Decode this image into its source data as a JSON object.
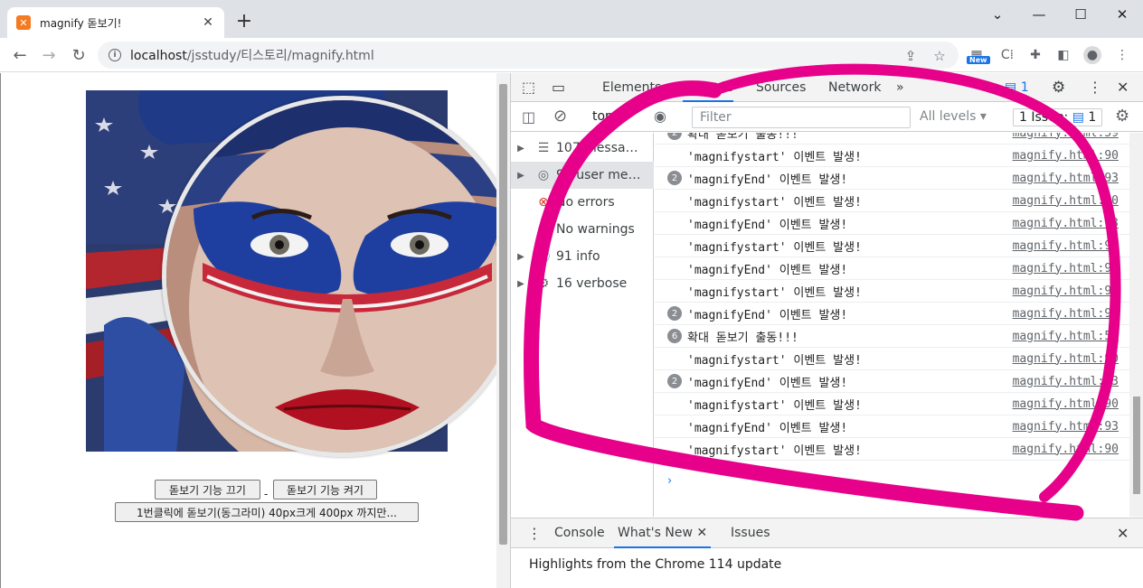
{
  "browser": {
    "tab_title": "magnify 돋보기!",
    "favicon": "xampp",
    "url_host": "localhost",
    "url_path": "/jsstudy/티스토리/magnify.html",
    "new_badge": "New"
  },
  "page": {
    "sep": "-",
    "btn_off": "돋보기 기능 끄기",
    "btn_on": "돋보기 기능 켜기",
    "btn_size": "1번클릭에 돋보기(동그라미) 40px크게 400px 까지만..."
  },
  "devtools": {
    "tabs": {
      "elements": "Elements",
      "console": "Console",
      "sources": "Sources",
      "network": "Network",
      "more": "»"
    },
    "issue_badge": "1",
    "context": "top",
    "filter_placeholder": "Filter",
    "levels": "All levels",
    "issues_label": "1 Issue:",
    "issues_count": "1",
    "sidebar": [
      {
        "label": "107 messa…",
        "icon": "list-icon"
      },
      {
        "label": "91 user me…",
        "icon": "user-icon"
      },
      {
        "label": "No errors",
        "icon": "error-icon"
      },
      {
        "label": "No warnings",
        "icon": "warning-icon"
      },
      {
        "label": "91 info",
        "icon": "info-icon"
      },
      {
        "label": "16 verbose",
        "icon": "verbose-icon"
      }
    ],
    "log": [
      {
        "count": "2",
        "text": "확대 돋보기 출동!!!",
        "src": "magnify.html:59"
      },
      {
        "count": "",
        "text": "'magnifystart' 이벤트 발생!",
        "src": "magnify.html:90"
      },
      {
        "count": "2",
        "text": "'magnifyEnd' 이벤트 발생!",
        "src": "magnify.html:93"
      },
      {
        "count": "",
        "text": "'magnifystart' 이벤트 발생!",
        "src": "magnify.html:90"
      },
      {
        "count": "",
        "text": "'magnifyEnd' 이벤트 발생!",
        "src": "magnify.html:93"
      },
      {
        "count": "",
        "text": "'magnifystart' 이벤트 발생!",
        "src": "magnify.html:90"
      },
      {
        "count": "",
        "text": "'magnifyEnd' 이벤트 발생!",
        "src": "magnify.html:93"
      },
      {
        "count": "",
        "text": "'magnifystart' 이벤트 발생!",
        "src": "magnify.html:90"
      },
      {
        "count": "2",
        "text": "'magnifyEnd' 이벤트 발생!",
        "src": "magnify.html:93"
      },
      {
        "count": "6",
        "text": "확대 돋보기 출동!!!",
        "src": "magnify.html:59"
      },
      {
        "count": "",
        "text": "'magnifystart' 이벤트 발생!",
        "src": "magnify.html:90"
      },
      {
        "count": "2",
        "text": "'magnifyEnd' 이벤트 발생!",
        "src": "magnify.html:93"
      },
      {
        "count": "",
        "text": "'magnifystart' 이벤트 발생!",
        "src": "magnify.html:90"
      },
      {
        "count": "",
        "text": "'magnifyEnd' 이벤트 발생!",
        "src": "magnify.html:93"
      },
      {
        "count": "",
        "text": "'magnifystart' 이벤트 발생!",
        "src": "magnify.html:90"
      }
    ],
    "prompt": "›",
    "drawer": {
      "tab_console": "Console",
      "tab_whatsnew": "What's New",
      "tab_issues": "Issues",
      "content": "Highlights from the Chrome 114 update"
    }
  },
  "colors": {
    "annotation": "#e6008a",
    "accent": "#1a73e8"
  }
}
